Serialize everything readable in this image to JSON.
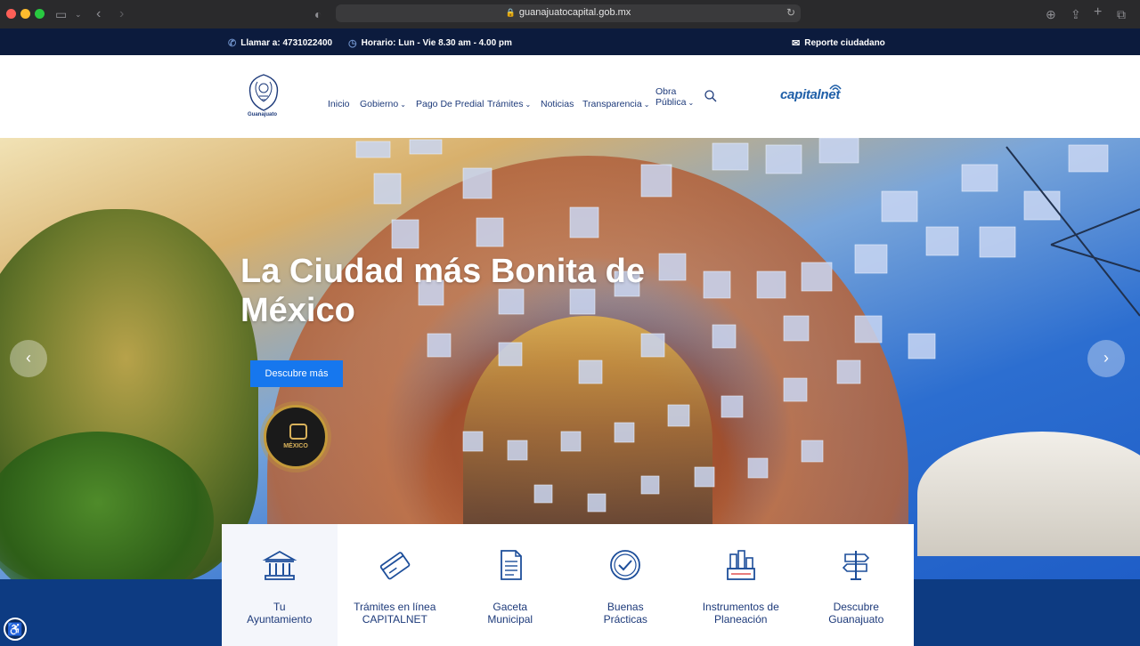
{
  "browser": {
    "url": "guanajuatocapital.gob.mx"
  },
  "topbar": {
    "phone": "Llamar a: 4731022400",
    "hours": "Horario: Lun - Vie 8.30 am - 4.00 pm",
    "report": "Reporte ciudadano"
  },
  "nav": {
    "logo_text": "Guanajuato",
    "items": [
      {
        "label": "Inicio"
      },
      {
        "label": "Gobierno"
      },
      {
        "label": "Pago De Predial"
      },
      {
        "label": "Trámites"
      },
      {
        "label": "Noticias"
      },
      {
        "label": "Transparencia"
      },
      {
        "label": "Obra"
      },
      {
        "label": "Pública"
      }
    ],
    "brand_a": "capital",
    "brand_b": "net"
  },
  "hero": {
    "title": "La Ciudad más Bonita de México",
    "cta": "Descubre más",
    "badge_text": "MÉXICO"
  },
  "cards": [
    {
      "label": "Tu\nAyuntamiento",
      "icon": "city-hall-icon"
    },
    {
      "label": "Trámites en línea\nCAPITALNET",
      "icon": "credit-card-icon"
    },
    {
      "label": "Gaceta\nMunicipal",
      "icon": "document-icon"
    },
    {
      "label": "Buenas\nPrácticas",
      "icon": "check-circle-icon"
    },
    {
      "label": "Instrumentos de\nPlaneación",
      "icon": "planning-icon"
    },
    {
      "label": "Descubre\nGuanajuato",
      "icon": "signpost-icon"
    }
  ],
  "colors": {
    "topbar": "#0c1b3d",
    "nav_text": "#1d3a7a",
    "cta": "#1677ee",
    "band": "#0d3b82"
  }
}
